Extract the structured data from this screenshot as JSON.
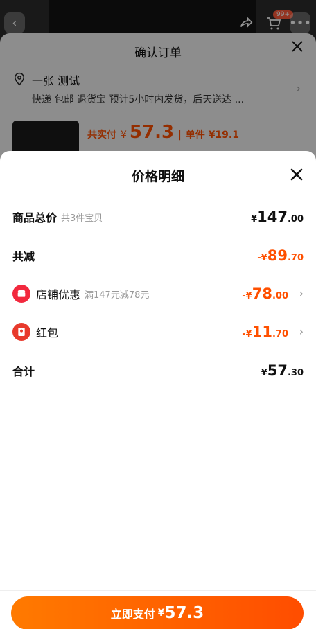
{
  "background": {
    "back_icon": "chevron-left-icon",
    "share_icon": "share-icon",
    "cart_badge": "99+",
    "more_icon": "more-dots-icon",
    "confirm_title": "确认订单",
    "close_icon": "close-icon",
    "address": {
      "name": "一张 测试",
      "detail": "快递 包邮 退货宝 预计5小时内发货，后天送达 ..."
    },
    "price_summary": {
      "label": "共实付",
      "yen": "¥",
      "amount": "57.3",
      "separator": "|",
      "unit_price": "单件 ¥19.1"
    }
  },
  "sheet": {
    "title": "价格明细",
    "close_icon": "close-icon",
    "rows": [
      {
        "label": "商品总价",
        "sub": "共3件宝贝",
        "yen": "¥",
        "int": "147",
        "dec": ".00",
        "color": "#111111"
      },
      {
        "label": "共减",
        "sub": "",
        "yen": "-¥",
        "int": "89",
        "dec": ".70",
        "color": "#ff5000"
      },
      {
        "label": "店铺优惠",
        "sub": "满147元减78元",
        "yen": "-¥",
        "int": "78",
        "dec": ".00",
        "color": "#ff5000",
        "icon": "shop-coupon-icon"
      },
      {
        "label": "红包",
        "sub": "",
        "yen": "-¥",
        "int": "11",
        "dec": ".70",
        "color": "#ff5000",
        "icon": "red-packet-icon"
      },
      {
        "label": "合计",
        "sub": "",
        "yen": "¥",
        "int": "57",
        "dec": ".30",
        "color": "#111111"
      }
    ]
  },
  "pay_button": {
    "label": "立即支付",
    "yen": "¥",
    "amount": "57.3"
  },
  "colors": {
    "accent": "#ff5000",
    "button_start": "#ff7a00",
    "button_end": "#ff4d00"
  }
}
